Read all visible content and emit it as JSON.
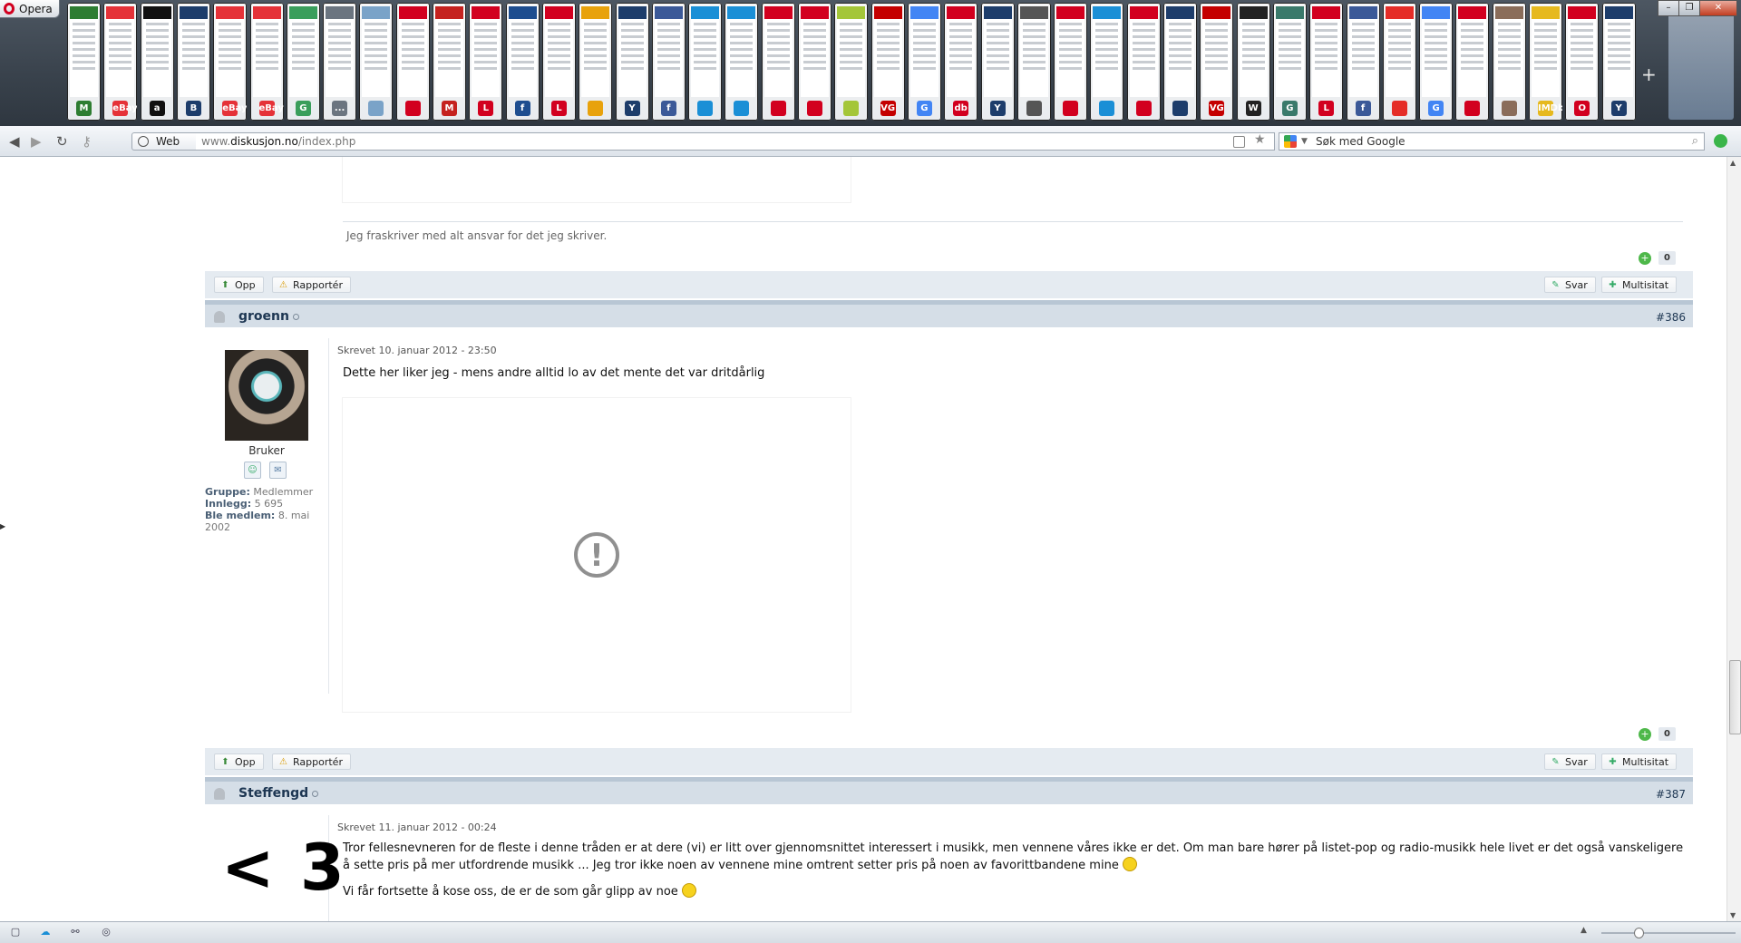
{
  "browser": {
    "menu_label": "Opera",
    "window_controls": [
      "minimize",
      "restore",
      "close"
    ],
    "new_tab_glyph": "+"
  },
  "tabs": [
    {
      "icon": "M",
      "color": "#2e7d32"
    },
    {
      "icon": "eBay",
      "color": "#e53238"
    },
    {
      "icon": "a",
      "color": "#111"
    },
    {
      "icon": "B",
      "color": "#1d3d6b"
    },
    {
      "icon": "eBay",
      "color": "#e53238"
    },
    {
      "icon": "eBay",
      "color": "#e53238"
    },
    {
      "icon": "G",
      "color": "#3a9e5b"
    },
    {
      "icon": "...",
      "color": "#6b7580"
    },
    {
      "icon": "",
      "color": "#7aa3c8"
    },
    {
      "icon": "",
      "color": "#d2001f"
    },
    {
      "icon": "M",
      "color": "#c5221f"
    },
    {
      "icon": "L",
      "color": "#d2001f"
    },
    {
      "icon": "f",
      "color": "#1d4d8f"
    },
    {
      "icon": "L",
      "color": "#d2001f"
    },
    {
      "icon": "",
      "color": "#e8a20c"
    },
    {
      "icon": "Y",
      "color": "#1d3d6b"
    },
    {
      "icon": "f",
      "color": "#3b5998"
    },
    {
      "icon": "",
      "color": "#1a8fd6"
    },
    {
      "icon": "",
      "color": "#1a8fd6"
    },
    {
      "icon": "",
      "color": "#d2001f"
    },
    {
      "icon": "",
      "color": "#d2001f"
    },
    {
      "icon": "",
      "color": "#a4c639"
    },
    {
      "icon": "VG",
      "color": "#c40000"
    },
    {
      "icon": "G",
      "color": "#4285f4"
    },
    {
      "icon": "db",
      "color": "#d2001f"
    },
    {
      "icon": "Y",
      "color": "#1d3d6b"
    },
    {
      "icon": "",
      "color": "#555"
    },
    {
      "icon": "",
      "color": "#d2001f"
    },
    {
      "icon": "",
      "color": "#1a8fd6"
    },
    {
      "icon": "",
      "color": "#d2001f"
    },
    {
      "icon": "",
      "color": "#1d3d6b"
    },
    {
      "icon": "VG",
      "color": "#c40000"
    },
    {
      "icon": "W",
      "color": "#222"
    },
    {
      "icon": "G",
      "color": "#3a7a6b"
    },
    {
      "icon": "L",
      "color": "#d2001f"
    },
    {
      "icon": "f",
      "color": "#3b5998"
    },
    {
      "icon": "",
      "color": "#e52d27"
    },
    {
      "icon": "G",
      "color": "#4285f4"
    },
    {
      "icon": "",
      "color": "#d2001f"
    },
    {
      "icon": "",
      "color": "#8a6d5a"
    },
    {
      "icon": "IMDb",
      "color": "#e6b91e"
    },
    {
      "icon": "O",
      "color": "#d2001f"
    },
    {
      "icon": "Y",
      "color": "#1d3d6b"
    }
  ],
  "address_bar": {
    "scope_label": "Web",
    "url_prefix": "www.",
    "url_domain": "diskusjon.no",
    "url_path": "/index.php",
    "search_placeholder": "Søk med Google"
  },
  "thread": {
    "signature_prev": "Jeg fraskriver med alt ansvar for det jeg skriver.",
    "buttons": {
      "up": "Opp",
      "report": "Rapportér",
      "reply": "Svar",
      "multiquote": "Multisitat"
    },
    "posts": [
      {
        "vote_count": "0"
      },
      {
        "username": "groenn",
        "post_number": "#386",
        "timestamp": "Skrevet 10. januar 2012 - 23:50",
        "text": "Dette her liker jeg - mens andre alltid lo av det mente det var dritdårlig",
        "rank": "Bruker",
        "group_label": "Gruppe:",
        "group_value": "Medlemmer",
        "posts_label": "Innlegg:",
        "posts_value": "5 695",
        "member_label": "Ble medlem:",
        "member_value": "8. mai 2002",
        "vote_count": "0"
      },
      {
        "username": "Steffengd",
        "post_number": "#387",
        "timestamp": "Skrevet 11. januar 2012 - 00:24",
        "avatar_text": "< 3",
        "paragraph1": "Tror fellesnevneren for de fleste i denne tråden er at dere (vi) er litt over gjennomsnittet interessert i musikk, men vennene våres ikke er det. Om man bare hører på listet-pop og radio-musikk hele livet er det også vanskeligere å sette pris på mer utfordrende musikk ... Jeg tror ikke noen av vennene mine omtrent setter pris på noen av favorittbandene mine",
        "paragraph2": "Vi får fortsette å kose oss, de er de som går glipp av noe"
      }
    ]
  }
}
